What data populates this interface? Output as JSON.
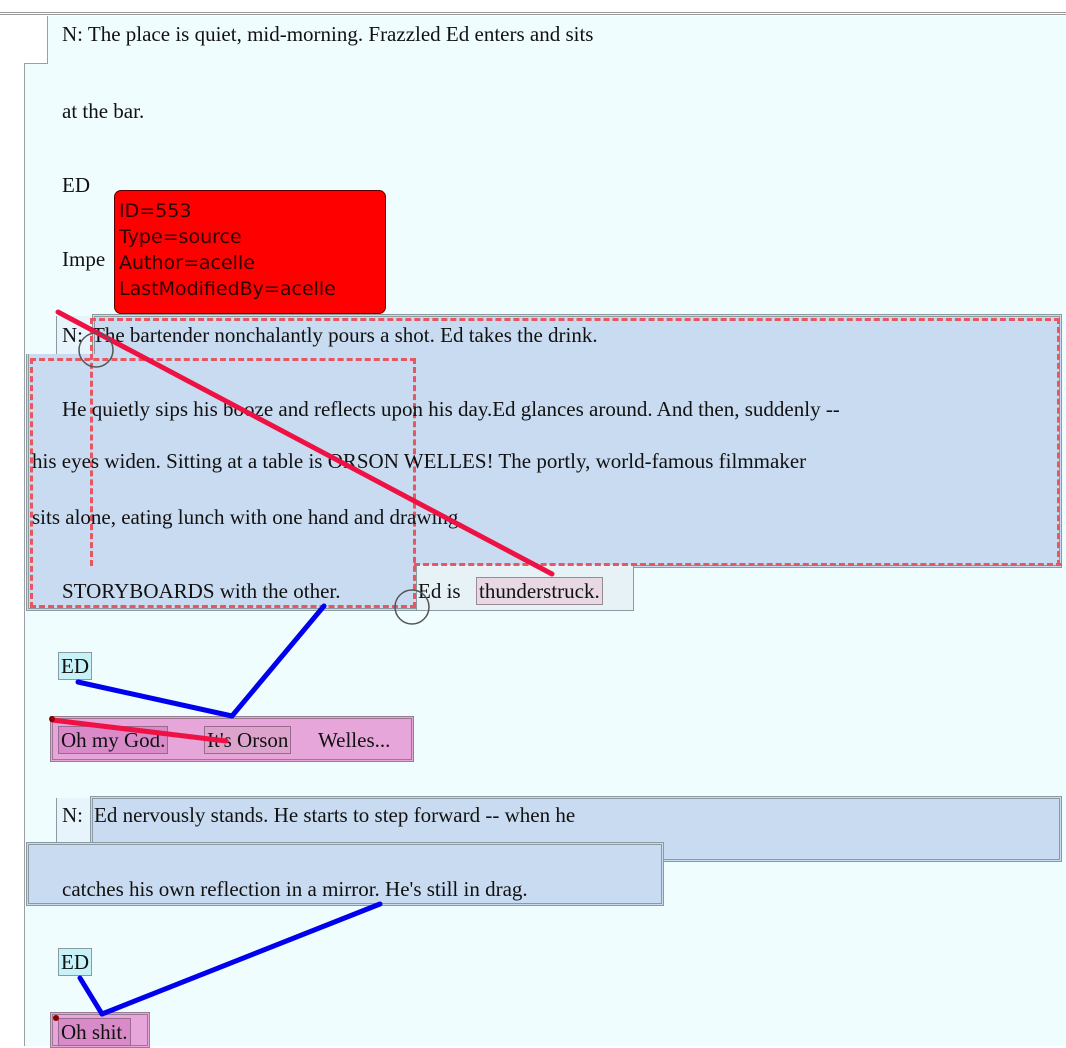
{
  "script": {
    "line_1": "N: The place is quiet, mid-morning.  Frazzled Ed enters and sits",
    "line_2": "at the bar.",
    "character_1": "ED",
    "dialogue_1": "Impe",
    "action_2a_label": "N:",
    "action_2a_text": "The bartender nonchalantly pours a shot.  Ed takes the drink.",
    "action_2b": "He quietly sips his booze and reflects upon his day.Ed glances around. And then, suddenly --",
    "action_2c": "his eyes widen. Sitting at a table is ORSON WELLES!  The portly, world-famous filmmaker",
    "action_2d": "sits alone, eating lunch with one hand and drawing",
    "action_2e": "STORYBOARDS with the other.",
    "action_2f": "Ed is",
    "action_2g": "thunderstruck.",
    "character_2": "ED",
    "dialogue_2a": "Oh my God.",
    "dialogue_2b": "It's Orson",
    "dialogue_2c": "Welles...",
    "action_3a_label": "N:",
    "action_3a_text": "Ed nervously stands.  He starts to step forward -- when he",
    "action_3b": "catches his own reflection in a mirror.  He's still in drag.",
    "character_3": "ED",
    "dialogue_3": "Oh shit."
  },
  "tooltip": {
    "id": "ID=553",
    "type": "Type=source",
    "author": "Author=acelle",
    "last_modified": "LastModifiedBy=acelle"
  },
  "colors": {
    "page_bg": "#f0fdff",
    "action_highlight": "#c9dbf0",
    "dialogue_highlight": "#e6a6d9",
    "character_highlight": "#c6f2f8",
    "tooltip_bg": "#ff0000",
    "source_link": "#ee1144",
    "target_link": "#0000ee"
  }
}
